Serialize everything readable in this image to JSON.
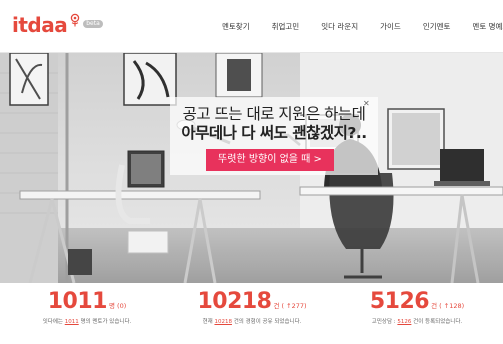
{
  "header": {
    "logo_text": "itdaa",
    "logo_badge": "beta",
    "nav": [
      "멘토찾기",
      "취업고민",
      "잇다 라운지",
      "가이드",
      "인기멘토",
      "멘토 명예의 전당"
    ]
  },
  "hero": {
    "headline_line1": "공고 뜨는 대로 지원은 하는데",
    "headline_line2": "아무데나 다 써도 괜찮겠지?..",
    "cta_label": "뚜렷한 방향이 없을 때 >",
    "close_symbol": "✕",
    "cta_color": "#e8325c"
  },
  "stats": [
    {
      "number": "1011",
      "unit": "명 (0)",
      "desc_prefix": "잇다에는",
      "desc_value": "1011",
      "desc_suffix": "명의 멘토가 있습니다."
    },
    {
      "number": "10218",
      "unit": "건 ( ↑277)",
      "desc_prefix": "현재",
      "desc_value": "10218",
      "desc_suffix": "건의 경험이 공유 되었습니다."
    },
    {
      "number": "5126",
      "unit": "건 ( ↑128)",
      "desc_prefix": "고민상담 :",
      "desc_value": "5126",
      "desc_suffix": "건이 등록되었습니다."
    }
  ],
  "colors": {
    "brand": "#e5493d"
  }
}
